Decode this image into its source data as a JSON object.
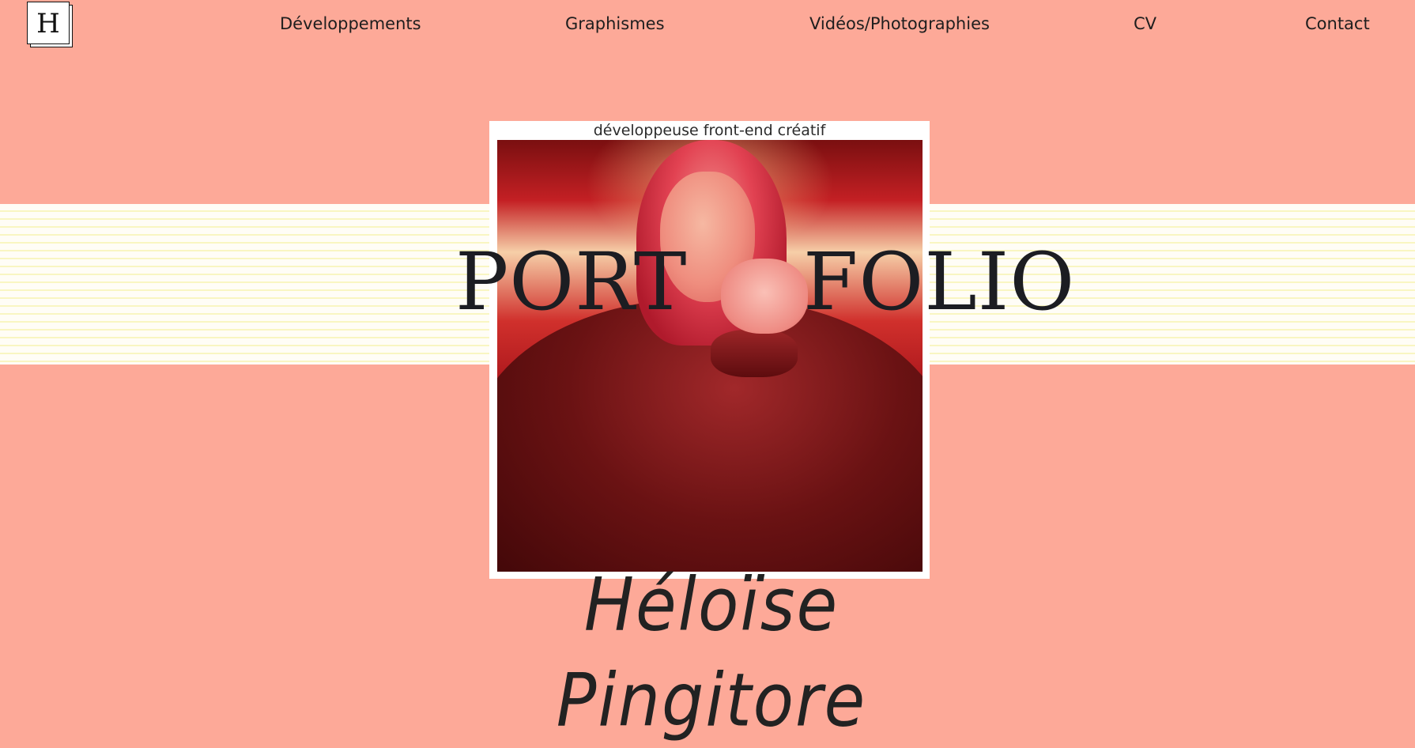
{
  "logo": {
    "letter": "H"
  },
  "nav": {
    "items": [
      {
        "label": "Développements"
      },
      {
        "label": "Graphismes"
      },
      {
        "label": "Vidéos/Photographies"
      },
      {
        "label": "CV"
      },
      {
        "label": "Contact"
      }
    ]
  },
  "hero": {
    "tagline": "développeuse front-end créatif",
    "title_left": "PORT",
    "title_right": "FOLIO",
    "name": "Héloïse Pingitore"
  },
  "colors": {
    "background": "#fda998",
    "band": "#fffdf6",
    "band_stripe": "#f9f6c2",
    "text": "#1c1d22"
  }
}
